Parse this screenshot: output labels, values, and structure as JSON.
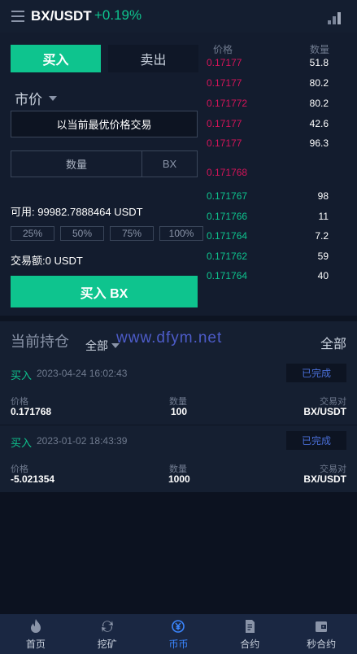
{
  "header": {
    "pair": "BX/USDT",
    "change": "+0.19%"
  },
  "trade": {
    "tab_buy": "买入",
    "tab_sell": "卖出",
    "order_type": "市价",
    "price_text": "以当前最优价格交易",
    "qty_label": "数量",
    "qty_unit": "BX",
    "available": "可用: 99982.7888464 USDT",
    "percents": [
      "25%",
      "50%",
      "75%",
      "100%"
    ],
    "amount": "交易额:0 USDT",
    "buy_button": "买入 BX"
  },
  "book": {
    "price_header": "价格",
    "qty_header": "数量",
    "asks": [
      {
        "price": "0.17177",
        "qty": "51.8"
      },
      {
        "price": "0.17177",
        "qty": "80.2"
      },
      {
        "price": "0.171772",
        "qty": "80.2"
      },
      {
        "price": "0.17177",
        "qty": "42.6"
      },
      {
        "price": "0.17177",
        "qty": "96.3"
      }
    ],
    "last_price": "0.171768",
    "bids": [
      {
        "price": "0.171767",
        "qty": "98"
      },
      {
        "price": "0.171766",
        "qty": "11"
      },
      {
        "price": "0.171764",
        "qty": "7.2"
      },
      {
        "price": "0.171762",
        "qty": "59"
      },
      {
        "price": "0.171764",
        "qty": "40"
      }
    ]
  },
  "holdings": {
    "title": "当前持仓",
    "filter": "全部",
    "all_link": "全部",
    "watermark": "www.dfym.net",
    "cards": [
      {
        "side": "买入",
        "time": "2023-04-24 16:02:43",
        "status": "已完成",
        "price_label": "价格",
        "price": "0.171768",
        "qty_label": "数量",
        "qty": "100",
        "pair_label": "交易对",
        "pair": "BX/USDT"
      },
      {
        "side": "买入",
        "time": "2023-01-02 18:43:39",
        "status": "已完成",
        "price_label": "价格",
        "price": "-5.021354",
        "qty_label": "数量",
        "qty": "1000",
        "pair_label": "交易对",
        "pair": "BX/USDT"
      }
    ]
  },
  "nav": [
    {
      "label": "首页",
      "icon": "fire-icon"
    },
    {
      "label": "挖矿",
      "icon": "refresh-icon"
    },
    {
      "label": "币币",
      "icon": "coin-icon",
      "active": true
    },
    {
      "label": "合约",
      "icon": "document-icon"
    },
    {
      "label": "秒合约",
      "icon": "wallet-icon"
    }
  ],
  "colors": {
    "green": "#0ec48e",
    "red": "#d6145a",
    "active_nav": "#3b86ff",
    "status_blue": "#4a6fd8"
  }
}
